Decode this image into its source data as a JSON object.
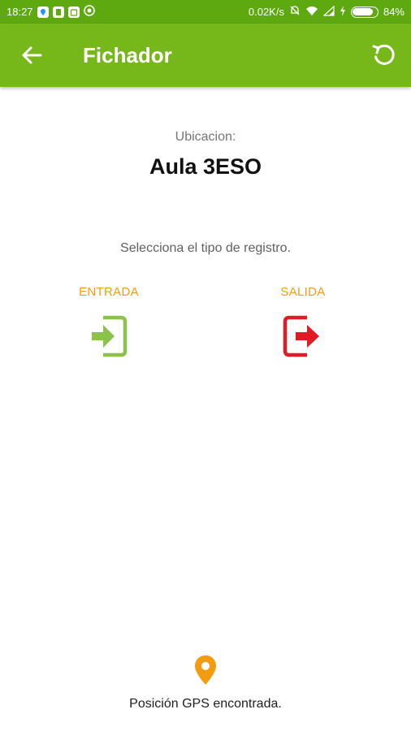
{
  "status_bar": {
    "time": "18:27",
    "network_speed": "0.02K/s",
    "battery_percent": "84%",
    "battery_level": 0.84,
    "icons": [
      "location-app-icon",
      "sim-app-icon",
      "calendar-app-icon",
      "whatsapp-icon",
      "alarm-off-icon",
      "wifi-icon",
      "signal-icon",
      "charging-icon",
      "battery-icon"
    ]
  },
  "app_bar": {
    "title": "Fichador",
    "back_icon": "arrow-back-icon",
    "refresh_icon": "refresh-icon",
    "color": "#76b81a"
  },
  "main": {
    "location_label": "Ubicacion:",
    "location_value": "Aula 3ESO",
    "instruction": "Selecciona el tipo de registro.",
    "entrada": {
      "label": "ENTRADA",
      "icon": "sign-in-icon",
      "color": "#8bc34a"
    },
    "salida": {
      "label": "SALIDA",
      "icon": "sign-out-icon",
      "color": "#e01b24"
    },
    "label_color": "#f39c12"
  },
  "footer": {
    "gps_icon": "map-pin-icon",
    "gps_color": "#f39c12",
    "gps_status": "Posición GPS encontrada."
  }
}
